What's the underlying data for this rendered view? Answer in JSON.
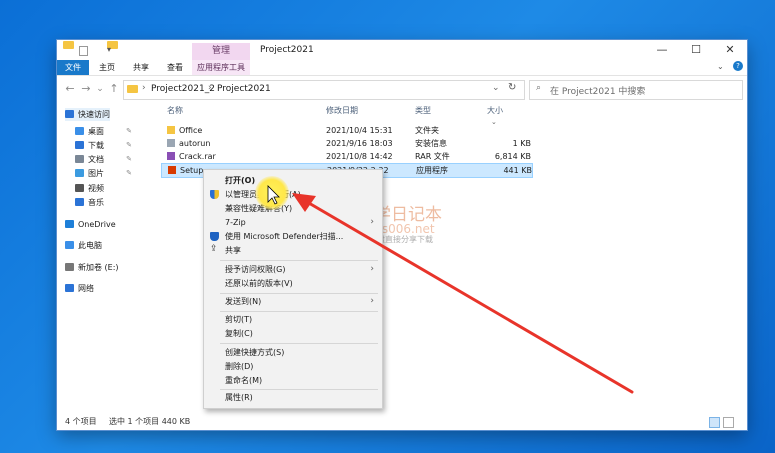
{
  "window": {
    "title": "Project2021",
    "contextual_tab_header": "管理",
    "controls": [
      "—",
      "☐",
      "✕"
    ]
  },
  "ribbon": {
    "tabs": [
      "文件",
      "主页",
      "共享",
      "查看",
      "应用程序工具"
    ]
  },
  "address": {
    "crumb1": "Project2021_2",
    "crumb2": "Project2021",
    "sep": "›",
    "search_placeholder": "在 Project2021 中搜索"
  },
  "sidebar": {
    "items": [
      {
        "label": "快速访问",
        "icon": "star-icon",
        "color": "#2b73d6"
      },
      {
        "label": "桌面",
        "icon": "desktop-icon",
        "color": "#3a8fe8",
        "pinned": true
      },
      {
        "label": "下载",
        "icon": "download-icon",
        "color": "#2b73d6",
        "pinned": true
      },
      {
        "label": "文档",
        "icon": "document-icon",
        "color": "#7a8796",
        "pinned": true
      },
      {
        "label": "图片",
        "icon": "picture-icon",
        "color": "#3b9be0",
        "pinned": true
      },
      {
        "label": "视频",
        "icon": "video-icon",
        "color": "#555555"
      },
      {
        "label": "音乐",
        "icon": "music-icon",
        "color": "#2b73d6"
      },
      {
        "label": "OneDrive",
        "icon": "cloud-icon",
        "color": "#1e7fd8"
      },
      {
        "label": "此电脑",
        "icon": "computer-icon",
        "color": "#3a8fe8"
      },
      {
        "label": "新加卷 (E:)",
        "icon": "drive-icon",
        "color": "#777777"
      },
      {
        "label": "网络",
        "icon": "network-icon",
        "color": "#2b73d6"
      }
    ],
    "pin_glyph": "✎"
  },
  "columns": {
    "name": "名称",
    "date": "修改日期",
    "type": "类型",
    "size": "大小"
  },
  "files": [
    {
      "name": "Office",
      "date": "2021/10/4 15:31",
      "type": "文件夹",
      "size": "",
      "icon": "folder-icon"
    },
    {
      "name": "autorun",
      "date": "2021/9/16 18:03",
      "type": "安装信息",
      "size": "1 KB",
      "icon": "settings-file-icon"
    },
    {
      "name": "Crack.rar",
      "date": "2021/10/8 14:42",
      "type": "RAR 文件",
      "size": "6,814 KB",
      "icon": "archive-icon"
    },
    {
      "name": "Setup",
      "date": "2021/9/22 2:32",
      "type": "应用程序",
      "size": "441 KB",
      "icon": "office-app-icon"
    }
  ],
  "context_menu": {
    "open": "打开(O)",
    "run_as_admin": "以管理员身份运行(A)",
    "compat": "兼容性疑难解答(Y)",
    "sevenzip": "7-Zip",
    "defender": "使用 Microsoft Defender扫描...",
    "share": "共享",
    "grant_access": "授予访问权限(G)",
    "restore": "还原以前的版本(V)",
    "send_to": "发送到(N)",
    "cut": "剪切(T)",
    "copy": "复制(C)",
    "shortcut": "创建快捷方式(S)",
    "delete": "删除(D)",
    "rename": "重命名(M)",
    "properties": "属性(R)",
    "submenu_glyph": "›"
  },
  "status": {
    "count": "4 个项目",
    "selected": "选中 1 个项目  440 KB"
  },
  "watermark": {
    "title": "丁同学日记本",
    "url": "www.ts006.net",
    "slogan": "软件、资源、教程网盘直接分享下载"
  },
  "colors": {
    "accent": "#1979ca",
    "selection": "#cce8ff",
    "arrow": "#e8342a"
  }
}
